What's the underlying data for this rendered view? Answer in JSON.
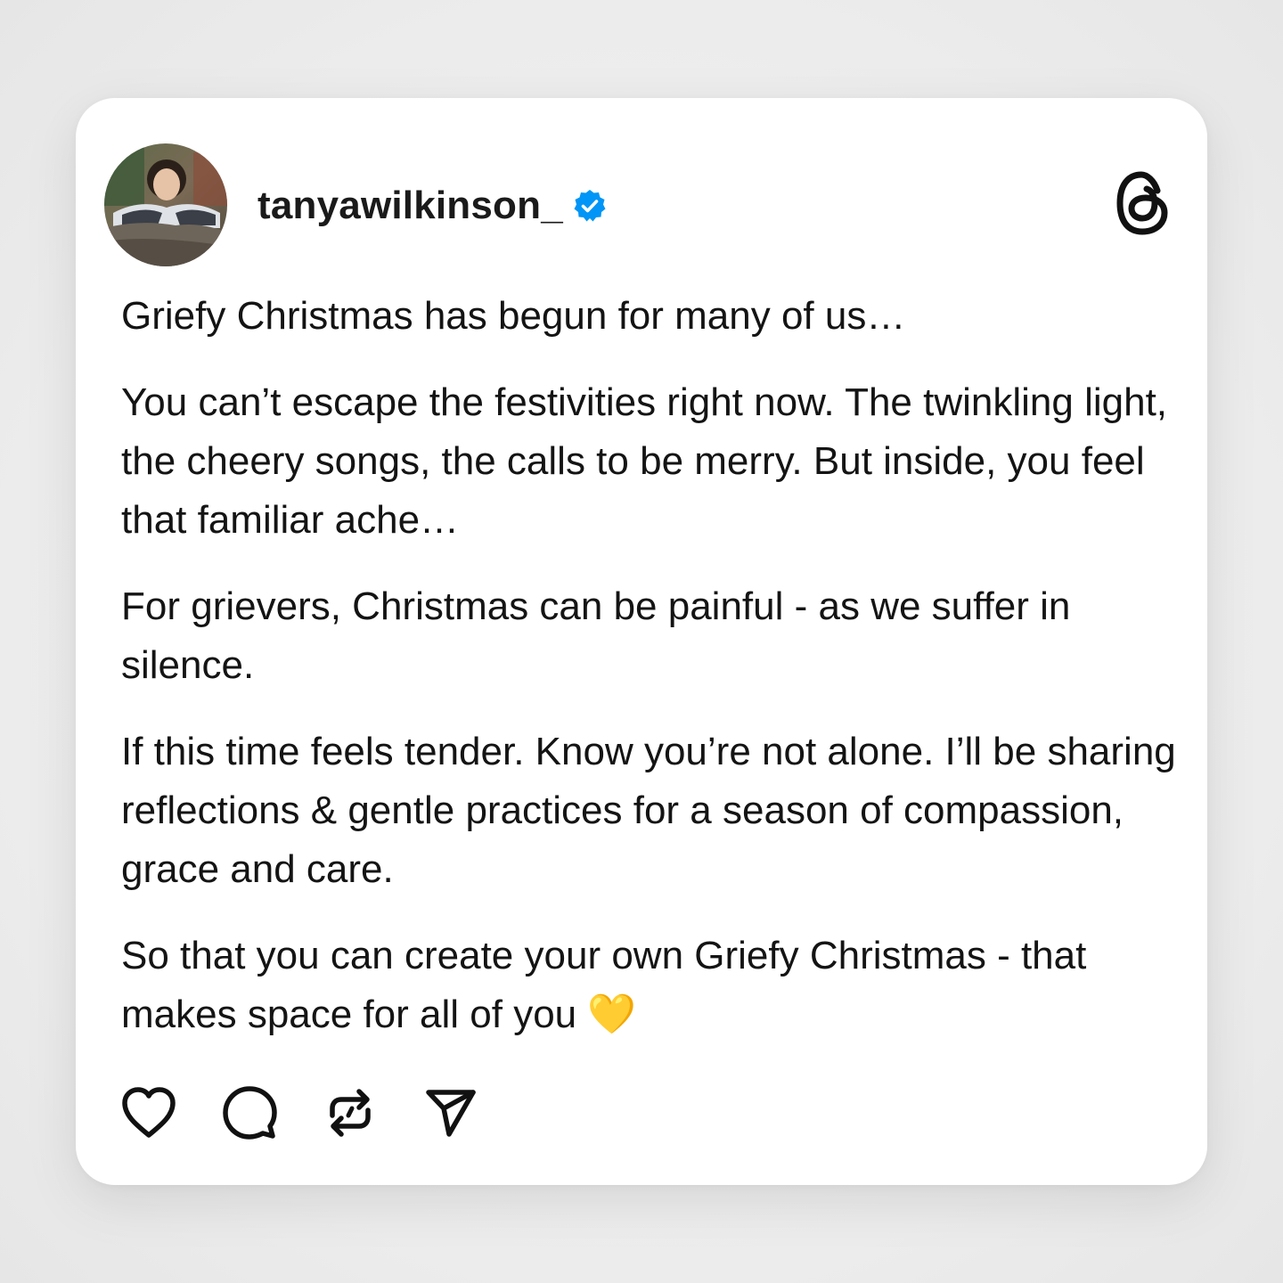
{
  "post": {
    "username": "tanyawilkinson_",
    "verified": true,
    "paragraphs": [
      "Griefy Christmas has begun for many of us…",
      "You can’t escape the festivities right now. The twinkling light, the cheery songs, the calls to be merry. But inside, you feel that familiar ache…",
      "For grievers, Christmas can be painful - as we suffer in silence.",
      "If this time feels tender. Know you’re not alone. I’ll be sharing reflections & gentle practices for a season of compassion, grace and care.",
      "So that you can create your own Griefy Christmas - that makes space for all of you 💛"
    ]
  },
  "icons": {
    "avatar": "avatar-photo",
    "verified": "verified-badge-icon",
    "brand": "threads-logo-icon",
    "like": "heart-icon",
    "comment": "comment-bubble-icon",
    "repost": "repost-icon",
    "share": "send-icon"
  },
  "colors": {
    "verified_blue": "#0095f6",
    "text": "#141414",
    "card_bg": "#ffffff",
    "page_bg": "#ececec"
  }
}
